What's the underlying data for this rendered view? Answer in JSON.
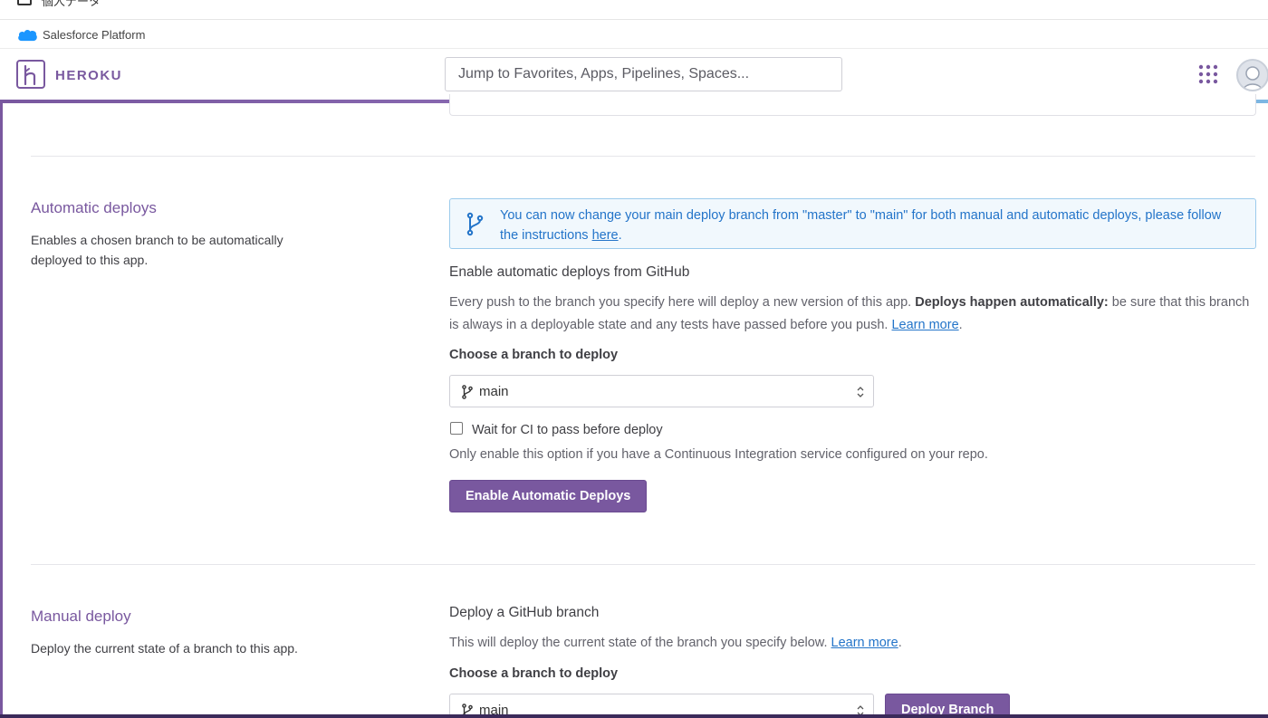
{
  "topbar": {
    "checkbox_label": "個人データ"
  },
  "salesforce_bar": {
    "label": "Salesforce Platform"
  },
  "header": {
    "brand": "HEROKU",
    "search_placeholder": "Jump to Favorites, Apps, Pipelines, Spaces..."
  },
  "automatic_deploys": {
    "title": "Automatic deploys",
    "description": "Enables a chosen branch to be automatically deployed to this app.",
    "info_message": "You can now change your main deploy branch from \"master\" to \"main\" for both manual and automatic deploys, please follow the instructions",
    "info_link": "here",
    "heading": "Enable automatic deploys from GitHub",
    "para_text": "Every push to the branch you specify here will deploy a new version of this app.",
    "para_bold": "Deploys happen automatically:",
    "para_text2": "be sure that this branch is always in a deployable state and any tests have passed before you push.",
    "learn_more": "Learn more",
    "branch_label": "Choose a branch to deploy",
    "branch_value": "main",
    "ci_checkbox_label": "Wait for CI to pass before deploy",
    "ci_checked": false,
    "ci_help": "Only enable this option if you have a Continuous Integration service configured on your repo.",
    "enable_button": "Enable Automatic Deploys"
  },
  "manual_deploy": {
    "title": "Manual deploy",
    "description": "Deploy the current state of a branch to this app.",
    "heading": "Deploy a GitHub branch",
    "para_text": "This will deploy the current state of the branch you specify below.",
    "learn_more": "Learn more",
    "branch_label": "Choose a branch to deploy",
    "branch_value": "main",
    "deploy_button": "Deploy Branch"
  },
  "colors": {
    "brand_purple": "#79589f",
    "info_blue": "#2374c9",
    "info_bg": "#f1f8fd"
  }
}
